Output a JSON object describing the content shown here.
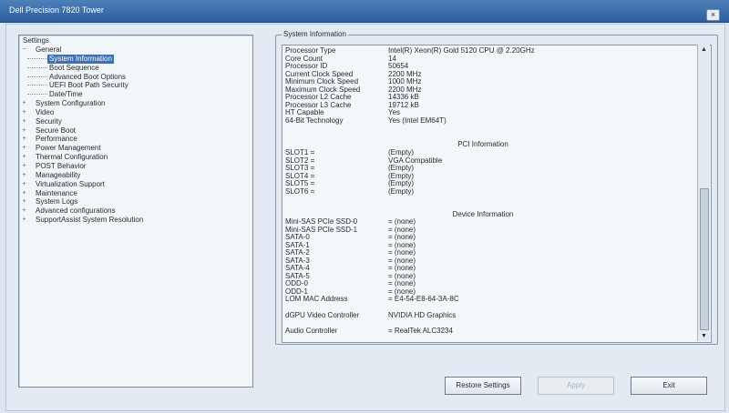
{
  "window": {
    "title": "Dell Precision 7820 Tower",
    "close_label": "×"
  },
  "tree": {
    "root_label": "Settings",
    "items": [
      {
        "label": "General",
        "expander": "−",
        "level": "top",
        "selected": false
      },
      {
        "label": "System Information",
        "expander": "",
        "level": "child",
        "selected": true
      },
      {
        "label": "Boot Sequence",
        "expander": "",
        "level": "child",
        "selected": false
      },
      {
        "label": "Advanced Boot Options",
        "expander": "",
        "level": "child",
        "selected": false
      },
      {
        "label": "UEFI Boot Path Security",
        "expander": "",
        "level": "child",
        "selected": false
      },
      {
        "label": "Date/Time",
        "expander": "",
        "level": "child",
        "selected": false
      },
      {
        "label": "System Configuration",
        "expander": "+",
        "level": "top",
        "selected": false
      },
      {
        "label": "Video",
        "expander": "+",
        "level": "top",
        "selected": false
      },
      {
        "label": "Security",
        "expander": "+",
        "level": "top",
        "selected": false
      },
      {
        "label": "Secure Boot",
        "expander": "+",
        "level": "top",
        "selected": false
      },
      {
        "label": "Performance",
        "expander": "+",
        "level": "top",
        "selected": false
      },
      {
        "label": "Power Management",
        "expander": "+",
        "level": "top",
        "selected": false
      },
      {
        "label": "Thermal Configuration",
        "expander": "+",
        "level": "top",
        "selected": false
      },
      {
        "label": "POST Behavior",
        "expander": "+",
        "level": "top",
        "selected": false
      },
      {
        "label": "Manageability",
        "expander": "+",
        "level": "top",
        "selected": false
      },
      {
        "label": "Virtualization Support",
        "expander": "+",
        "level": "top",
        "selected": false
      },
      {
        "label": "Maintenance",
        "expander": "+",
        "level": "top",
        "selected": false
      },
      {
        "label": "System Logs",
        "expander": "+",
        "level": "top",
        "selected": false
      },
      {
        "label": "Advanced configurations",
        "expander": "+",
        "level": "top",
        "selected": false
      },
      {
        "label": "SupportAssist System Resolution",
        "expander": "+",
        "level": "top",
        "selected": false
      }
    ]
  },
  "info": {
    "group_title": "System Information",
    "processor": [
      {
        "k": "Processor Type",
        "v": "Intel(R) Xeon(R) Gold 5120 CPU @ 2.20GHz"
      },
      {
        "k": "Core Count",
        "v": "14"
      },
      {
        "k": "Processor ID",
        "v": "50654"
      },
      {
        "k": "Current Clock Speed",
        "v": "2200 MHz"
      },
      {
        "k": "Minimum Clock Speed",
        "v": "1000 MHz"
      },
      {
        "k": "Maximum Clock Speed",
        "v": "2200 MHz"
      },
      {
        "k": "Processor L2 Cache",
        "v": "14336 kB"
      },
      {
        "k": "Processor L3 Cache",
        "v": "19712 kB"
      },
      {
        "k": "HT Capable",
        "v": "Yes"
      },
      {
        "k": "64-Bit Technology",
        "v": "Yes (Intel EM64T)"
      }
    ],
    "pci_title": "PCI Information",
    "pci": [
      {
        "k": "SLOT1 =",
        "v": "(Empty)"
      },
      {
        "k": "SLOT2 =",
        "v": "VGA Compatible"
      },
      {
        "k": "SLOT3 =",
        "v": "(Empty)"
      },
      {
        "k": "SLOT4 =",
        "v": "(Empty)"
      },
      {
        "k": "SLOT5 =",
        "v": "(Empty)"
      },
      {
        "k": "SLOT6 =",
        "v": "(Empty)"
      }
    ],
    "device_title": "Device Information",
    "devices": [
      {
        "k": "Mini-SAS PCIe SSD-0",
        "v": "= (none)"
      },
      {
        "k": "Mini-SAS PCIe SSD-1",
        "v": "= (none)"
      },
      {
        "k": "SATA-0",
        "v": "= (none)"
      },
      {
        "k": "SATA-1",
        "v": "= (none)"
      },
      {
        "k": "SATA-2",
        "v": "= (none)"
      },
      {
        "k": "SATA-3",
        "v": "= (none)"
      },
      {
        "k": "SATA-4",
        "v": "= (none)"
      },
      {
        "k": "SATA-5",
        "v": "= (none)"
      },
      {
        "k": "ODD-0",
        "v": "= (none)"
      },
      {
        "k": "ODD-1",
        "v": "= (none)"
      },
      {
        "k": "LOM MAC Address",
        "v": "= E4-54-E8-64-3A-8C"
      }
    ],
    "gpu": {
      "k": "dGPU Video Controller",
      "v": "NVIDIA HD Graphics"
    },
    "audio": {
      "k": "Audio Controller",
      "v": "= RealTek ALC3234"
    }
  },
  "buttons": {
    "restore": "Restore Settings",
    "apply": "Apply",
    "exit": "Exit"
  },
  "scroll": {
    "up_icon": "▲",
    "down_icon": "▼"
  }
}
